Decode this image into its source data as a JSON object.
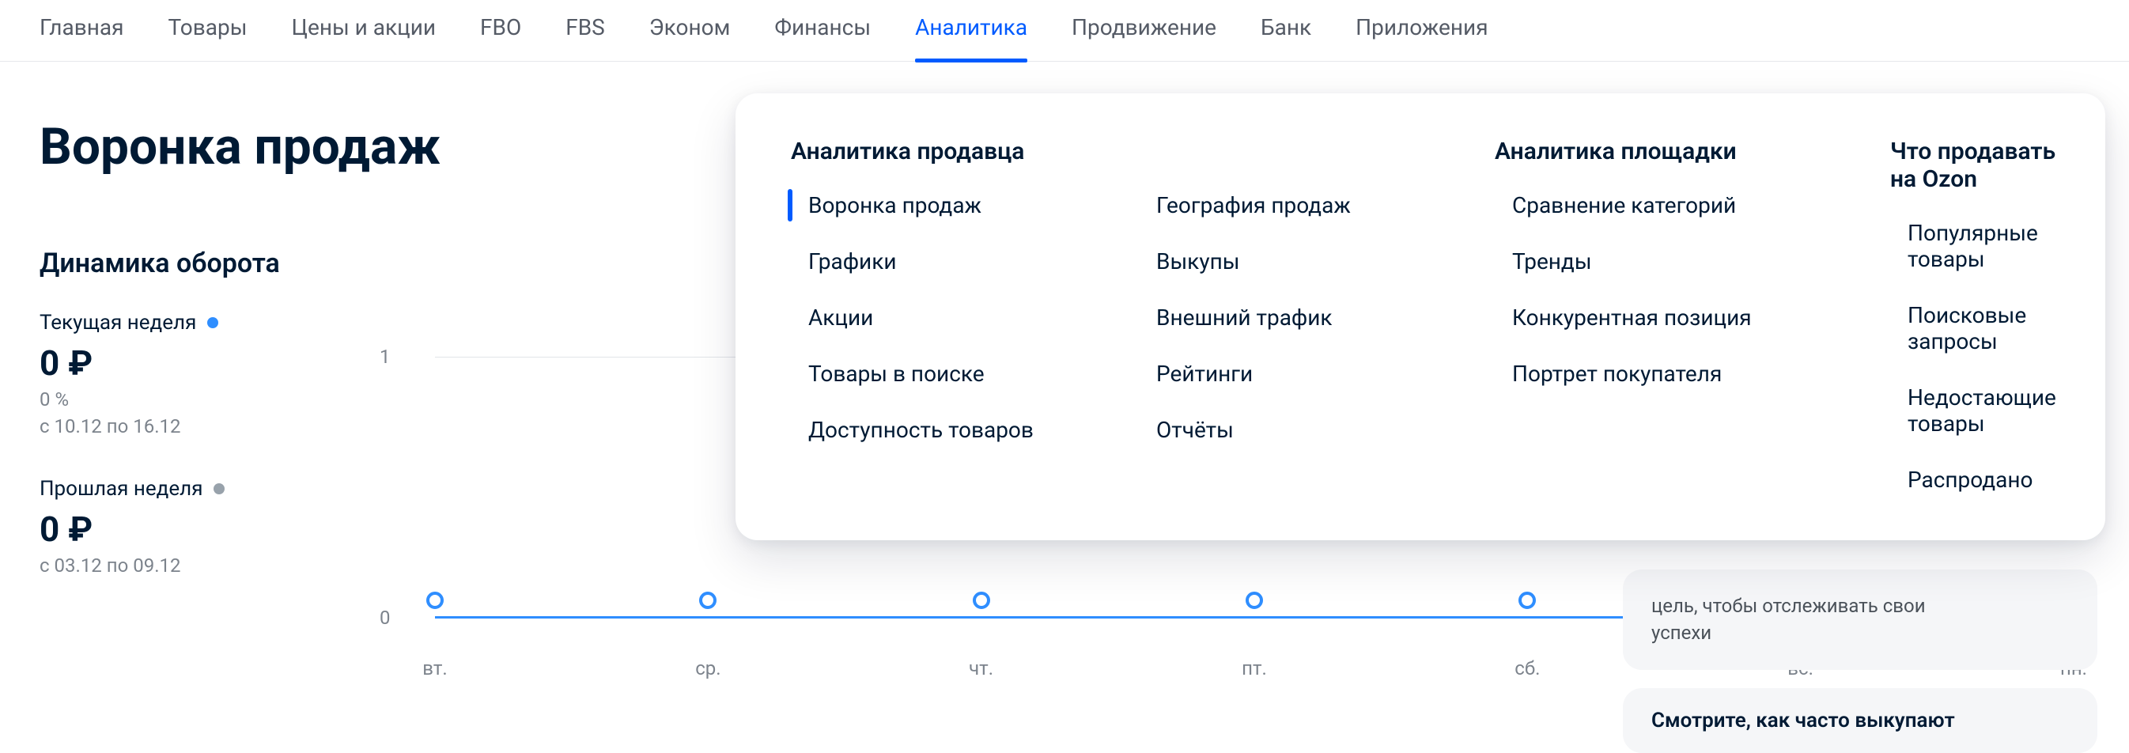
{
  "nav": {
    "items": [
      "Главная",
      "Товары",
      "Цены и акции",
      "FBO",
      "FBS",
      "Эконом",
      "Финансы",
      "Аналитика",
      "Продвижение",
      "Банк",
      "Приложения"
    ],
    "active_index": 7
  },
  "page": {
    "title": "Воронка продаж",
    "section_title": "Динамика оборота"
  },
  "legend": {
    "current": {
      "label": "Текущая неделя",
      "value": "0 ₽",
      "percent": "0 %",
      "range": "с 10.12 по 16.12"
    },
    "previous": {
      "label": "Прошлая неделя",
      "value": "0 ₽",
      "range": "с 03.12 по 09.12"
    }
  },
  "chart_data": {
    "type": "line",
    "categories": [
      "вт.",
      "ср.",
      "чт.",
      "пт.",
      "сб.",
      "вс.",
      "пн."
    ],
    "series": [
      {
        "name": "Текущая неделя",
        "color": "#2f8eff",
        "values": [
          0,
          0,
          0,
          0,
          0,
          0,
          0
        ]
      }
    ],
    "ylabel": "",
    "xlabel": "",
    "ylim": [
      0,
      1
    ],
    "yticks": [
      0,
      1
    ]
  },
  "mega": {
    "columns": [
      {
        "heading": "Аналитика продавца",
        "items_a": [
          "Воронка продаж",
          "Графики",
          "Акции",
          "Товары в поиске",
          "Доступность товаров"
        ],
        "items_b": [
          "География продаж",
          "Выкупы",
          "Внешний трафик",
          "Рейтинги",
          "Отчёты"
        ]
      },
      {
        "heading": "Аналитика площадки",
        "items": [
          "Сравнение категорий",
          "Тренды",
          "Конкурентная позиция",
          "Портрет покупателя"
        ]
      },
      {
        "heading": "Что продавать на Ozon",
        "items": [
          "Популярные товары",
          "Поисковые запросы",
          "Недостающие товары",
          "Распродано"
        ]
      }
    ],
    "active_item": "Воронка продаж"
  },
  "side": {
    "card1_line1": "цель, чтобы отслеживать свои",
    "card1_line2": "успехи",
    "card2": "Смотрите, как часто выкупают"
  }
}
